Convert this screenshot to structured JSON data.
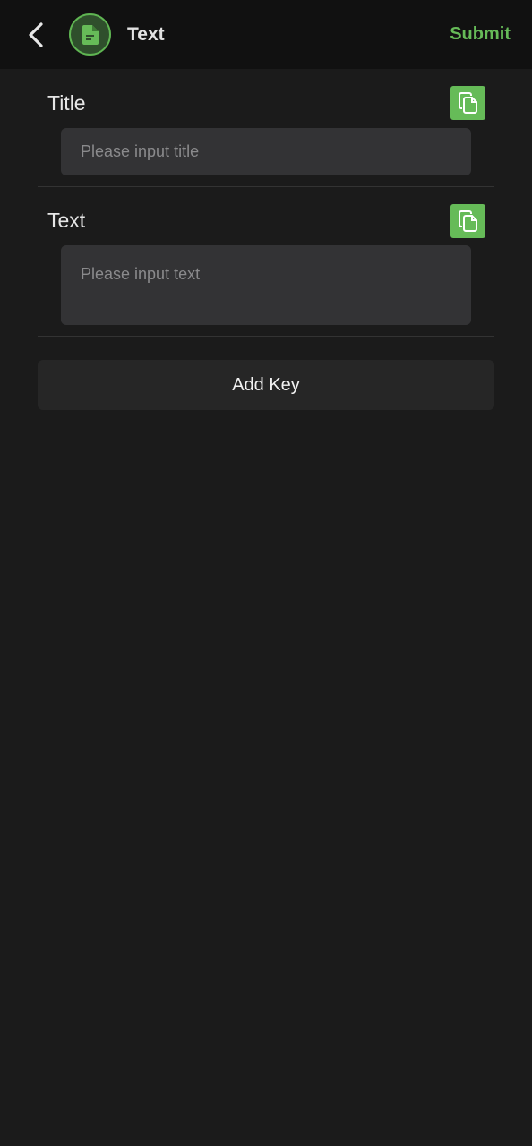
{
  "colors": {
    "accent": "#66bb58",
    "background": "#1b1b1b",
    "header_background": "#111111"
  },
  "header": {
    "back_icon": "chevron-left-icon",
    "app_icon": "document-icon",
    "title": "Text",
    "submit_label": "Submit"
  },
  "fields": [
    {
      "label": "Title",
      "placeholder": "Please input title",
      "value": "",
      "copy_icon": "copy-icon"
    },
    {
      "label": "Text",
      "placeholder": "Please input text",
      "value": "",
      "copy_icon": "copy-icon"
    }
  ],
  "add_key": {
    "label": "Add Key"
  }
}
